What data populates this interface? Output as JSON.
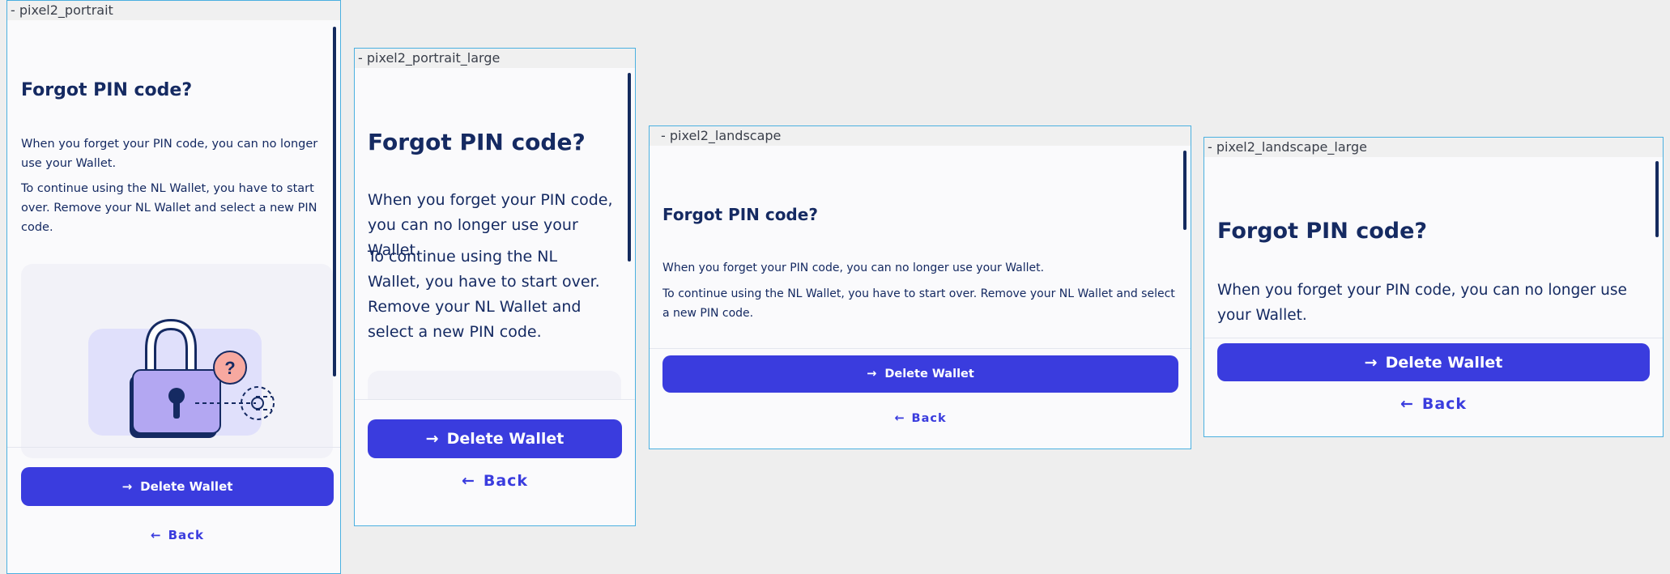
{
  "colors": {
    "background": "#eeeeee",
    "screen_bg": "#fafafc",
    "frame_border": "#4bb0e0",
    "primary": "#3a3cde",
    "text": "#152a62",
    "scrollbar": "#142a5e"
  },
  "icons": {
    "forward_arrow": "→",
    "back_arrow": "←",
    "question": "?"
  },
  "frames": {
    "portrait": {
      "label": "- pixel2_portrait",
      "title": "Forgot PIN code?",
      "para1": "When you forget your PIN code, you can no longer use your Wallet.",
      "para2": "To continue using the NL Wallet, you have to start over. Remove your NL Wallet and select a new PIN code.",
      "primary_button": "Delete Wallet",
      "secondary_button": "Back"
    },
    "portrait_large": {
      "label": "- pixel2_portrait_large",
      "title": "Forgot PIN code?",
      "para1": "When you forget your PIN code, you can no longer use your Wallet.",
      "para2": "To continue using the NL Wallet, you have to start over. Remove your NL Wallet and select a new PIN code.",
      "primary_button": "Delete Wallet",
      "secondary_button": "Back"
    },
    "landscape": {
      "label": "- pixel2_landscape",
      "title": "Forgot PIN code?",
      "para1": "When you forget your PIN code, you can no longer use your Wallet.",
      "para2": "To continue using the NL Wallet, you have to start over. Remove your NL Wallet and select a new PIN code.",
      "primary_button": "Delete Wallet",
      "secondary_button": "Back"
    },
    "landscape_large": {
      "label": "- pixel2_landscape_large",
      "title": "Forgot PIN code?",
      "para1": "When you forget your PIN code, you can no longer use your Wallet.",
      "primary_button": "Delete Wallet",
      "secondary_button": "Back"
    }
  }
}
